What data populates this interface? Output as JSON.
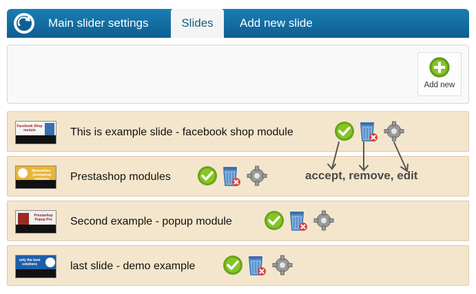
{
  "nav": {
    "tabs": [
      {
        "label": "Main slider settings"
      },
      {
        "label": "Slides",
        "active": true
      },
      {
        "label": "Add new slide"
      }
    ]
  },
  "toolbar": {
    "add_new_label": "Add new"
  },
  "slides": [
    {
      "title": "This is example slide - facebook shop module",
      "thumb_text": "Facebook Shop module"
    },
    {
      "title": "Prestashop modules",
      "thumb_text": "Mymodules - prestashop modules"
    },
    {
      "title": "Second example - popup module",
      "thumb_text": "Prestashop Popup Pro"
    },
    {
      "title": "last slide - demo example",
      "thumb_text": "only the best solutions"
    }
  ],
  "annotation": {
    "text": "accept, remove, edit"
  },
  "colors": {
    "nav_bar": "#0d5f91",
    "row_bg": "#f4e6cc",
    "accept_green": "#7ab317"
  },
  "icons": [
    "logo-icon",
    "plus-icon",
    "accept-icon",
    "remove-icon",
    "edit-gear-icon"
  ]
}
